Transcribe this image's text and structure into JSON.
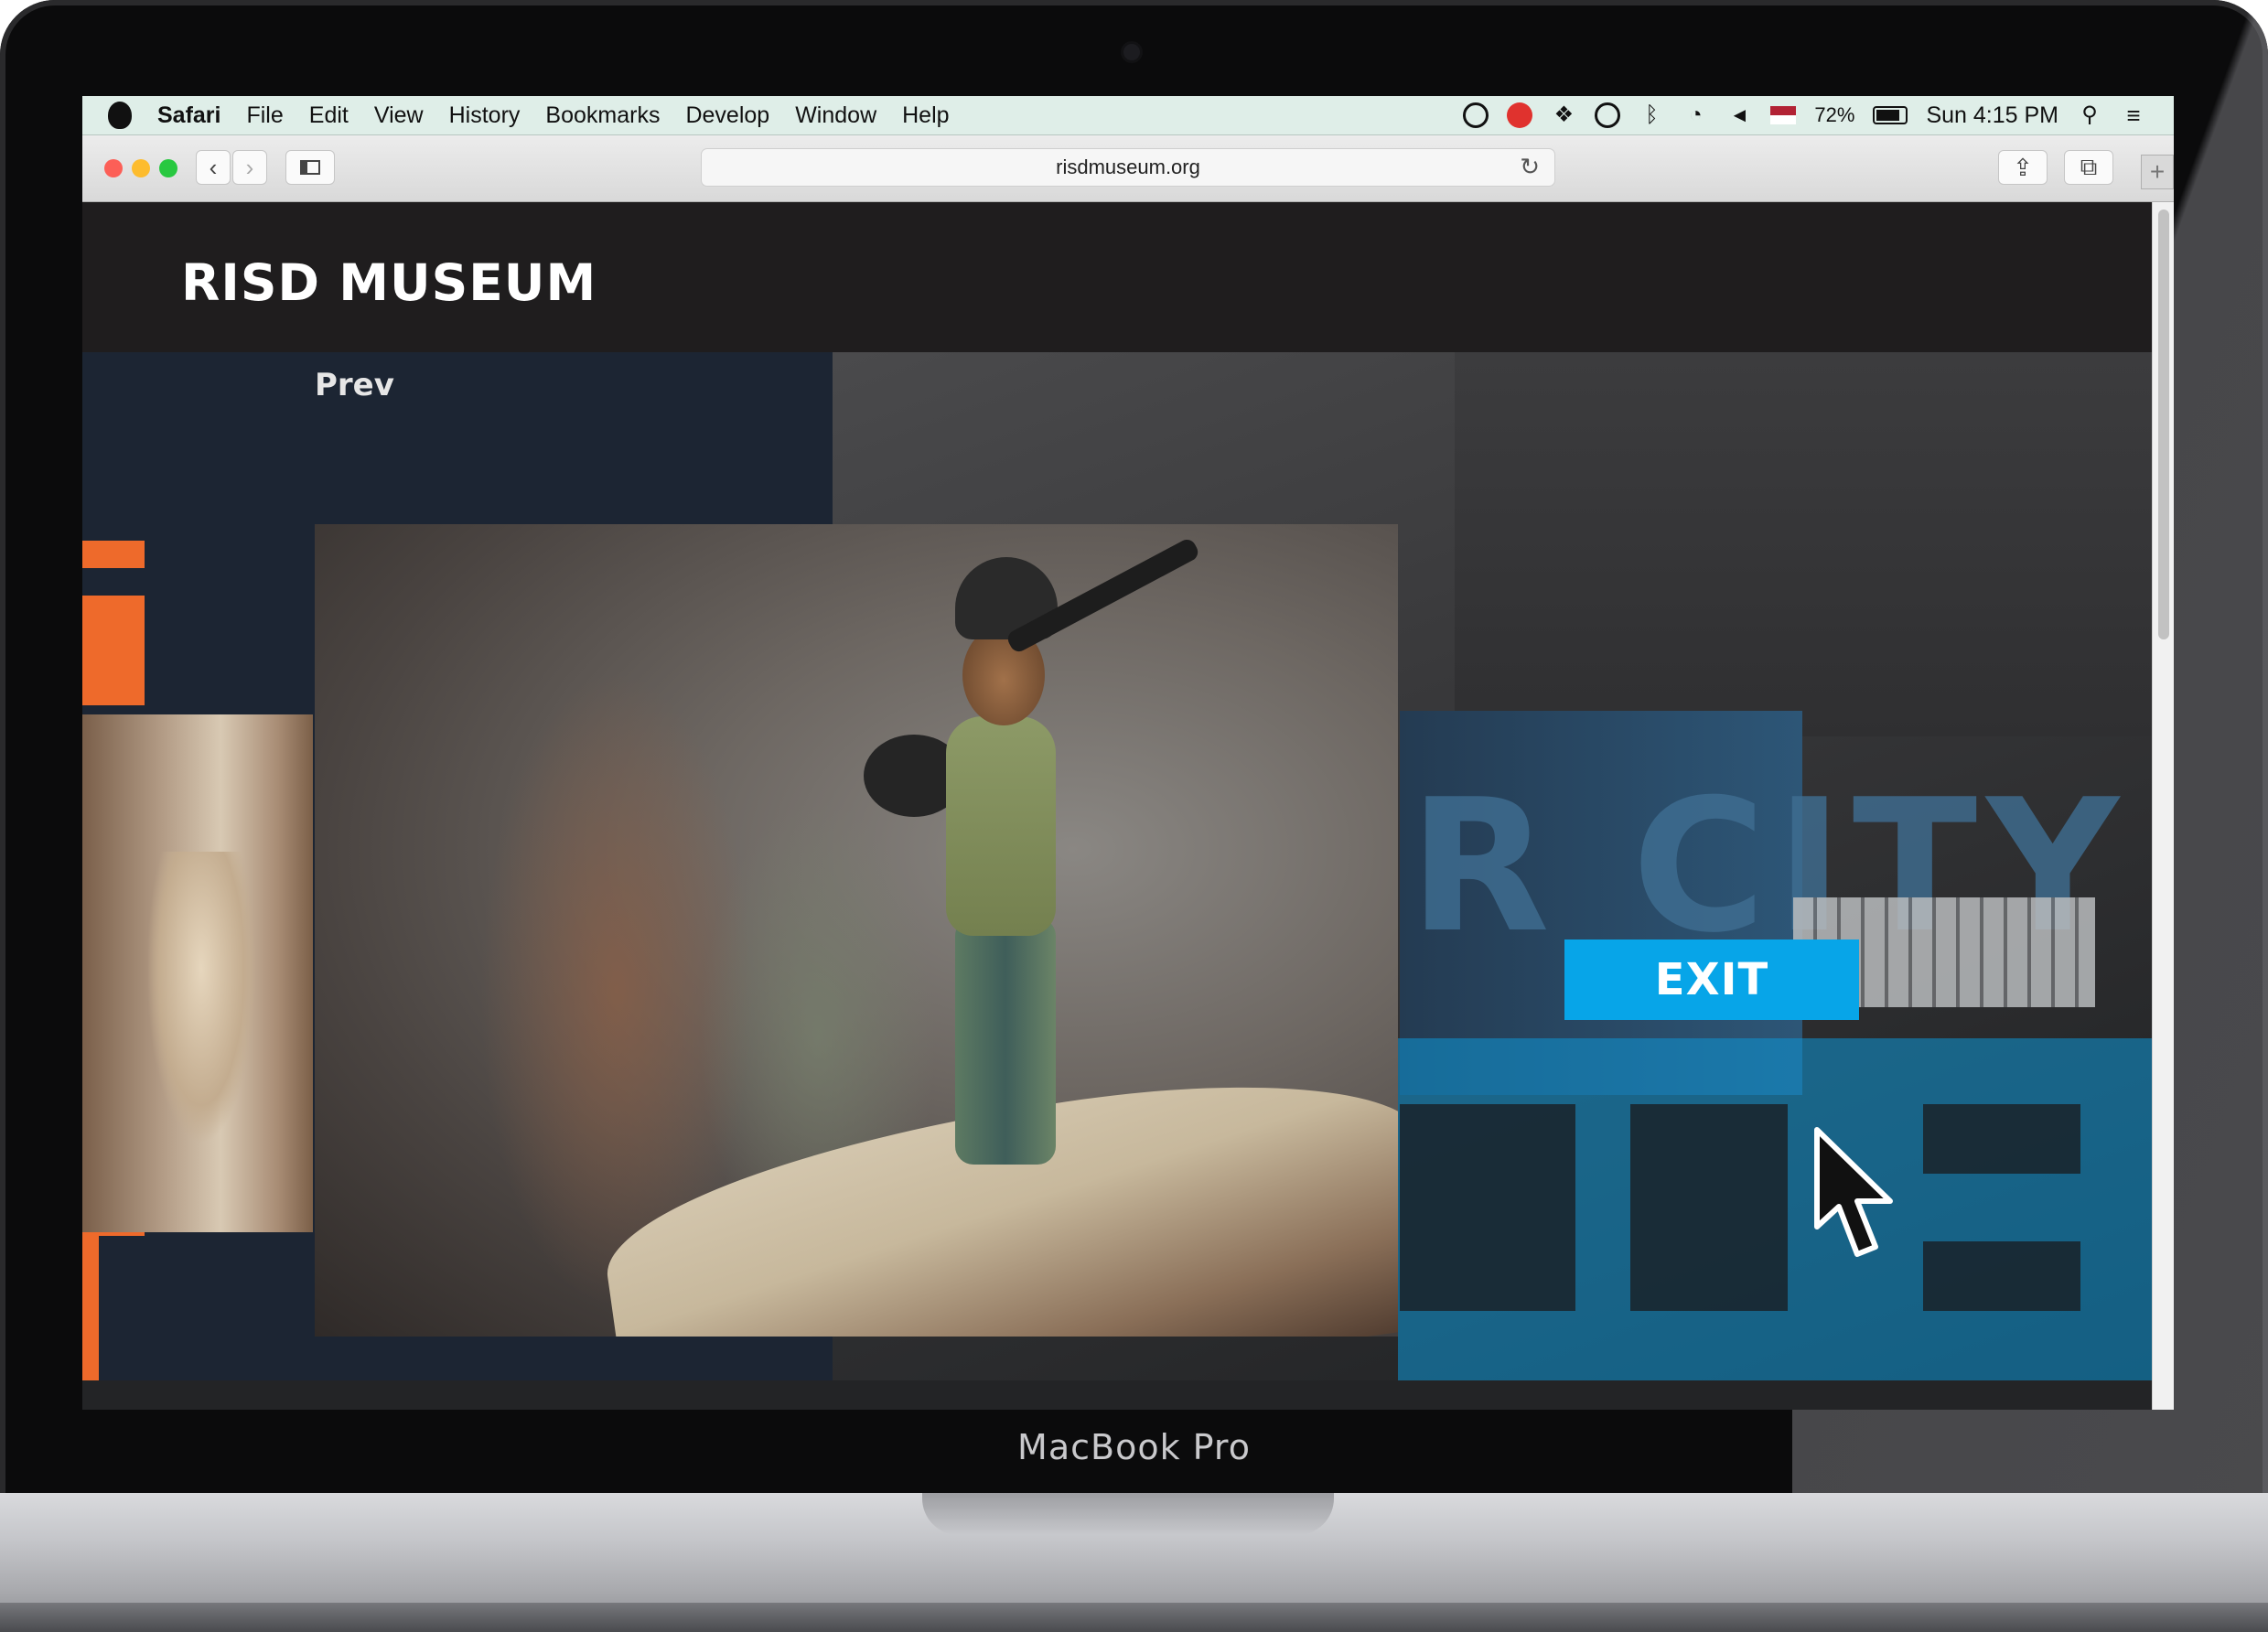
{
  "device": {
    "brand_label": "MacBook Pro"
  },
  "menubar": {
    "app_name": "Safari",
    "items": [
      "File",
      "Edit",
      "View",
      "History",
      "Bookmarks",
      "Develop",
      "Window",
      "Help"
    ],
    "battery_percent": "72%",
    "clock": "Sun 4:15 PM"
  },
  "browser": {
    "url": "risdmuseum.org"
  },
  "site": {
    "logo": "RISD MUSEUM",
    "prev_label": "Prev",
    "exit_label": "EXIT",
    "wall_text": "R CITY"
  },
  "colors": {
    "accent_orange": "#ee6a2b",
    "accent_blue": "#07a5e8",
    "header_bg": "#1f1d1e",
    "page_navy": "#1c2533"
  }
}
